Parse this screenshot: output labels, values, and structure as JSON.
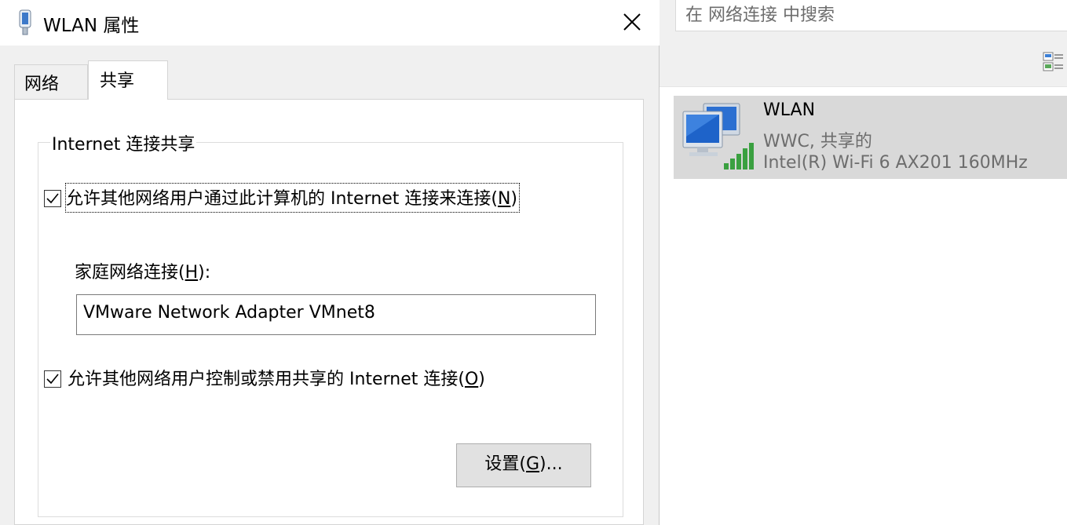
{
  "explorer": {
    "search_placeholder": "在 网络连接 中搜索",
    "connection": {
      "name": "WLAN",
      "status": "WWC, 共享的",
      "device": "Intel(R) Wi-Fi 6 AX201 160MHz"
    }
  },
  "dialog": {
    "title": "WLAN 属性",
    "tabs": [
      {
        "label": "网络",
        "active": false
      },
      {
        "label": "共享",
        "active": true
      }
    ],
    "group_title": "Internet 连接共享",
    "allow_sharing": {
      "checked": true,
      "label": "允许其他网络用户通过此计算机的 Internet 连接来连接(",
      "mnemonic": "N",
      "label_end": ")"
    },
    "home_network": {
      "label": "家庭网络连接(",
      "mnemonic": "H",
      "label_end": "):",
      "value": "VMware Network Adapter VMnet8"
    },
    "allow_control": {
      "checked": true,
      "label": "允许其他网络用户控制或禁用共享的 Internet 连接(",
      "mnemonic": "O",
      "label_end": ")"
    },
    "settings_button": {
      "label": "设置(",
      "mnemonic": "G",
      "label_end": ")..."
    }
  },
  "colors": {
    "dialog_bg": "#f0f0f0",
    "selected_item_bg": "#d9d9d9",
    "signal_green": "#3aa040"
  }
}
